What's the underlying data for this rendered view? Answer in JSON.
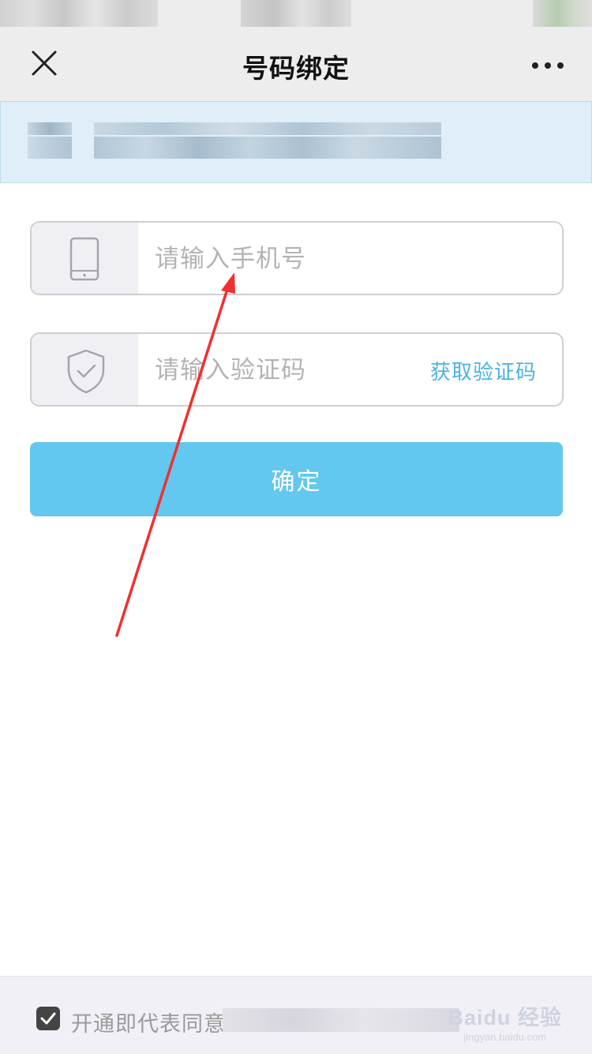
{
  "nav": {
    "title": "号码绑定"
  },
  "phone_field": {
    "placeholder": "请输入手机号",
    "icon": "phone-icon"
  },
  "code_field": {
    "placeholder": "请输入验证码",
    "icon": "shield-check-icon",
    "get_code_label": "获取验证码"
  },
  "confirm_label": "确定",
  "agreement": {
    "text": "开通即代表同意",
    "checked": true
  },
  "watermark": {
    "main": "Baidu 经验",
    "sub": "jingyan.baidu.com"
  },
  "colors": {
    "accent": "#63c7ef",
    "link": "#4ab4e6",
    "arrow": "#f0302f",
    "banner": "#dfeef8"
  }
}
